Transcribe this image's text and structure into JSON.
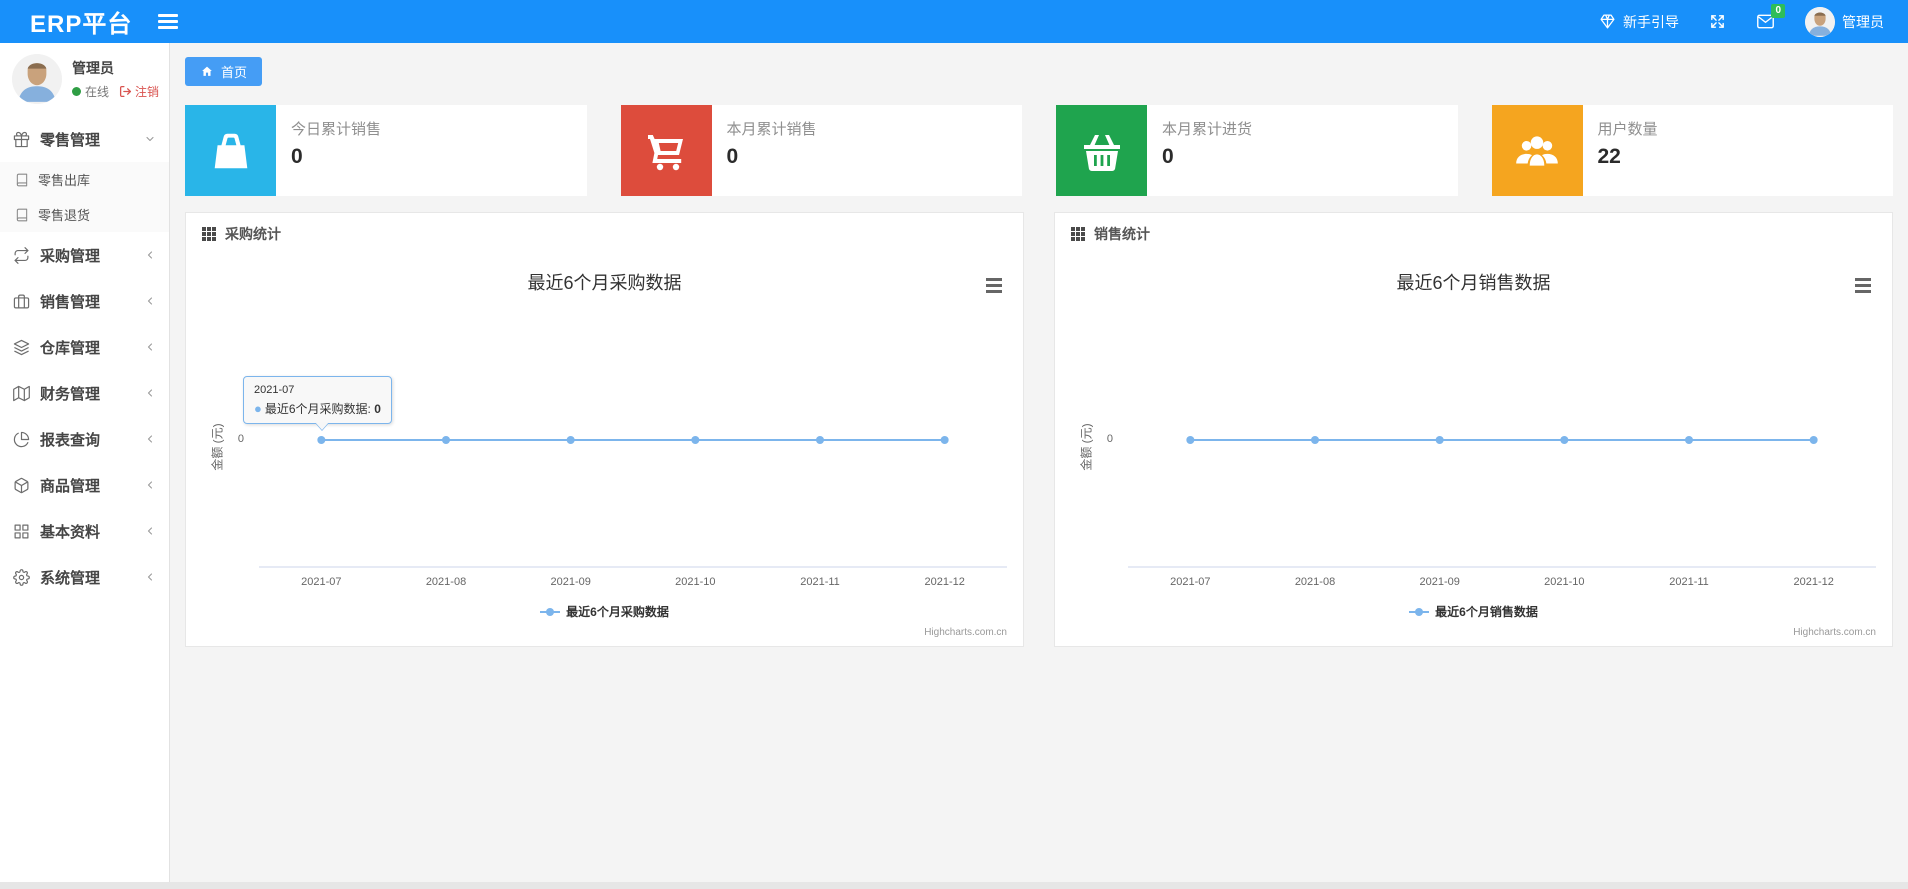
{
  "navbar": {
    "brand": "ERP平台",
    "guide_label": "新手引导",
    "mail_badge": "0",
    "username": "管理员"
  },
  "sidebar": {
    "user_name": "管理员",
    "status_online": "在线",
    "logout_label": "注销",
    "items": [
      {
        "label": "零售管理"
      },
      {
        "label": "零售出库"
      },
      {
        "label": "零售退货"
      },
      {
        "label": "采购管理"
      },
      {
        "label": "销售管理"
      },
      {
        "label": "仓库管理"
      },
      {
        "label": "财务管理"
      },
      {
        "label": "报表查询"
      },
      {
        "label": "商品管理"
      },
      {
        "label": "基本资料"
      },
      {
        "label": "系统管理"
      }
    ]
  },
  "tabs": {
    "home_label": "首页"
  },
  "stat_cards": [
    {
      "label": "今日累计销售",
      "value": "0",
      "color": "#29b5e8",
      "icon": "shopping-bag-icon"
    },
    {
      "label": "本月累计销售",
      "value": "0",
      "color": "#dd4c3c",
      "icon": "cart-icon"
    },
    {
      "label": "本月累计进货",
      "value": "0",
      "color": "#1fa44e",
      "icon": "basket-icon"
    },
    {
      "label": "用户数量",
      "value": "22",
      "color": "#f5a51f",
      "icon": "users-icon"
    }
  ],
  "panels": [
    {
      "title": "采购统计"
    },
    {
      "title": "销售统计"
    }
  ],
  "chart_data": [
    {
      "type": "line",
      "title": "最近6个月采购数据",
      "categories": [
        "2021-07",
        "2021-08",
        "2021-09",
        "2021-10",
        "2021-11",
        "2021-12"
      ],
      "series": [
        {
          "name": "最近6个月采购数据",
          "values": [
            0,
            0,
            0,
            0,
            0,
            0
          ]
        }
      ],
      "xlabel": "",
      "ylabel": "金额 (元)",
      "ytick_label": "0",
      "ylim": [
        -1,
        1
      ],
      "grid": false,
      "legend_position": "bottom",
      "line_color": "#7cb5ec",
      "axis_color": "#ccd6eb",
      "credit": "Highcharts.com.cn",
      "tooltip": {
        "visible": true,
        "date": "2021-07",
        "series_label": "最近6个月采购数据: ",
        "value": "0",
        "marker": "●"
      }
    },
    {
      "type": "line",
      "title": "最近6个月销售数据",
      "categories": [
        "2021-07",
        "2021-08",
        "2021-09",
        "2021-10",
        "2021-11",
        "2021-12"
      ],
      "series": [
        {
          "name": "最近6个月销售数据",
          "values": [
            0,
            0,
            0,
            0,
            0,
            0
          ]
        }
      ],
      "xlabel": "",
      "ylabel": "金额 (元)",
      "ytick_label": "0",
      "ylim": [
        -1,
        1
      ],
      "grid": false,
      "legend_position": "bottom",
      "line_color": "#7cb5ec",
      "axis_color": "#ccd6eb",
      "credit": "Highcharts.com.cn",
      "tooltip": {
        "visible": false
      }
    }
  ]
}
